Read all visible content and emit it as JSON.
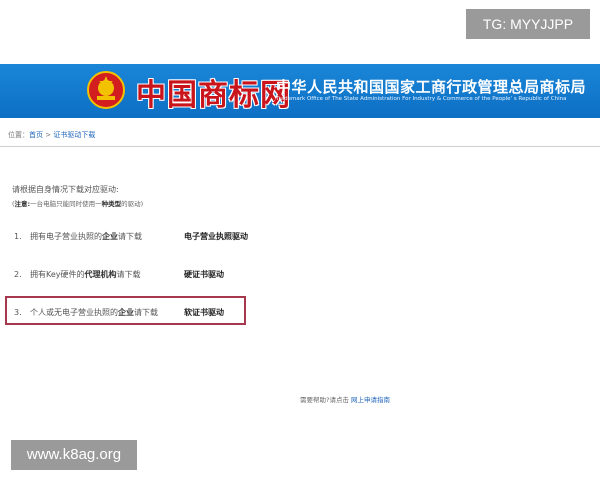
{
  "watermark_top": "TG: MYYJJPP",
  "watermark_bottom": "www.k8ag.org",
  "header": {
    "logo_text": "中国商标网",
    "title": "中华人民共和国国家工商行政管理总局商标局",
    "subtitle": "Trademark Office of The State Administration For Industry & Commerce of the People' s Republic of China",
    "bg_color": "#1a86d8",
    "logo_color": "#c9141b"
  },
  "breadcrumb": {
    "prefix": "位置：",
    "home": "首页",
    "separator": " > ",
    "current": "证书驱动下载"
  },
  "content": {
    "intro": "请根据自身情况下载对应驱动:",
    "note_open": "(",
    "note_label": "注意:",
    "note_text": "一台电脑只能同时使用一",
    "note_strong": "种类型",
    "note_tail": "的驱动)",
    "options": [
      {
        "num": "1.",
        "pre": "拥有电子营业执照的",
        "strong": "企业",
        "post": "请下载",
        "driver": "电子营业执照驱动"
      },
      {
        "num": "2.",
        "pre": "拥有Key硬件的",
        "strong": "代理机构",
        "post": "请下载",
        "driver": "硬证书驱动"
      },
      {
        "num": "3.",
        "pre": "个人或无电子营业执照的",
        "strong": "企业",
        "post": "请下载",
        "driver": "软证书驱动"
      }
    ],
    "highlight_color": "#a6384d"
  },
  "footer": {
    "text": "需要帮助?请点击",
    "link": "网上申请指南"
  }
}
